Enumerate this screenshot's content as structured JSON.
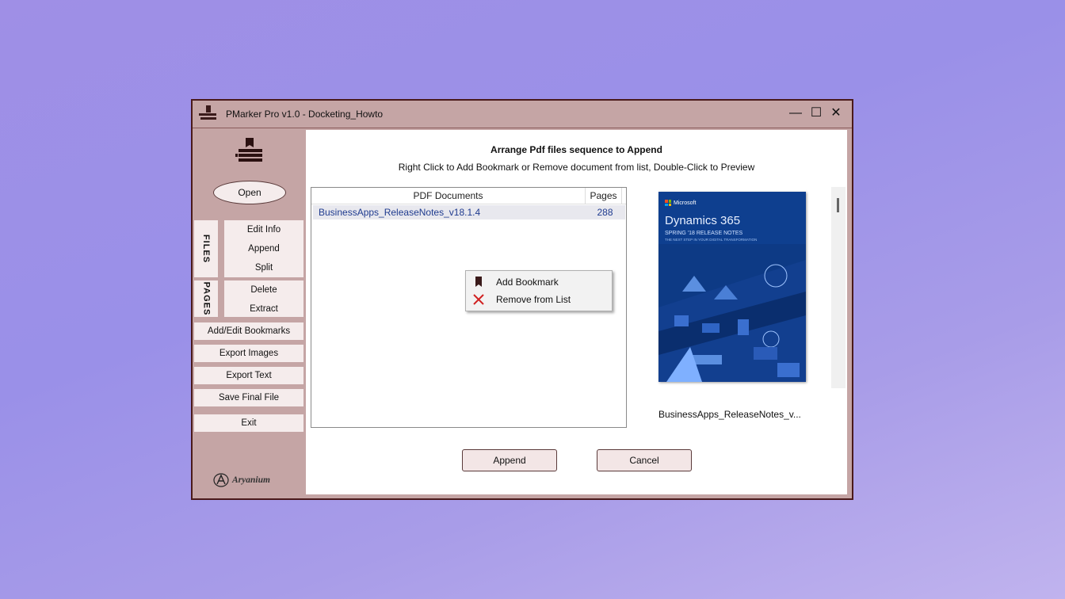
{
  "window": {
    "title": "PMarker Pro v1.0 - Docketing_Howto",
    "controls": {
      "minimize": "—",
      "maximize": "☐",
      "close": "✕"
    }
  },
  "sidebar": {
    "open_label": "Open",
    "files_tab": "FILES",
    "pages_tab": "PAGES",
    "files_items": [
      "Edit Info",
      "Append",
      "Split"
    ],
    "pages_items": [
      "Delete",
      "Extract"
    ],
    "buttons": [
      "Add/Edit Bookmarks",
      "Export Images",
      "Export Text",
      "Save Final File",
      "Exit"
    ],
    "brand": "Aryanium"
  },
  "main": {
    "heading": "Arrange Pdf files sequence to Append",
    "subheading": "Right Click to Add Bookmark or Remove document from list, Double-Click to Preview",
    "list": {
      "columns": [
        "PDF Documents",
        "Pages"
      ],
      "rows": [
        {
          "name": "BusinessApps_ReleaseNotes_v18.1.4",
          "pages": "288"
        }
      ]
    },
    "context_menu": [
      "Add Bookmark",
      "Remove from List"
    ],
    "preview": {
      "brand": "Microsoft",
      "title": "Dynamics 365",
      "subtitle": "SPRING '18 RELEASE NOTES",
      "tagline": "THE NEXT STEP IN YOUR DIGITAL TRANSFORMATION",
      "caption": "BusinessApps_ReleaseNotes_v..."
    },
    "append_label": "Append",
    "cancel_label": "Cancel"
  },
  "colors": {
    "accent": "#c5a5a5",
    "border": "#4a1a1a",
    "cover": "#0e3f8f"
  }
}
